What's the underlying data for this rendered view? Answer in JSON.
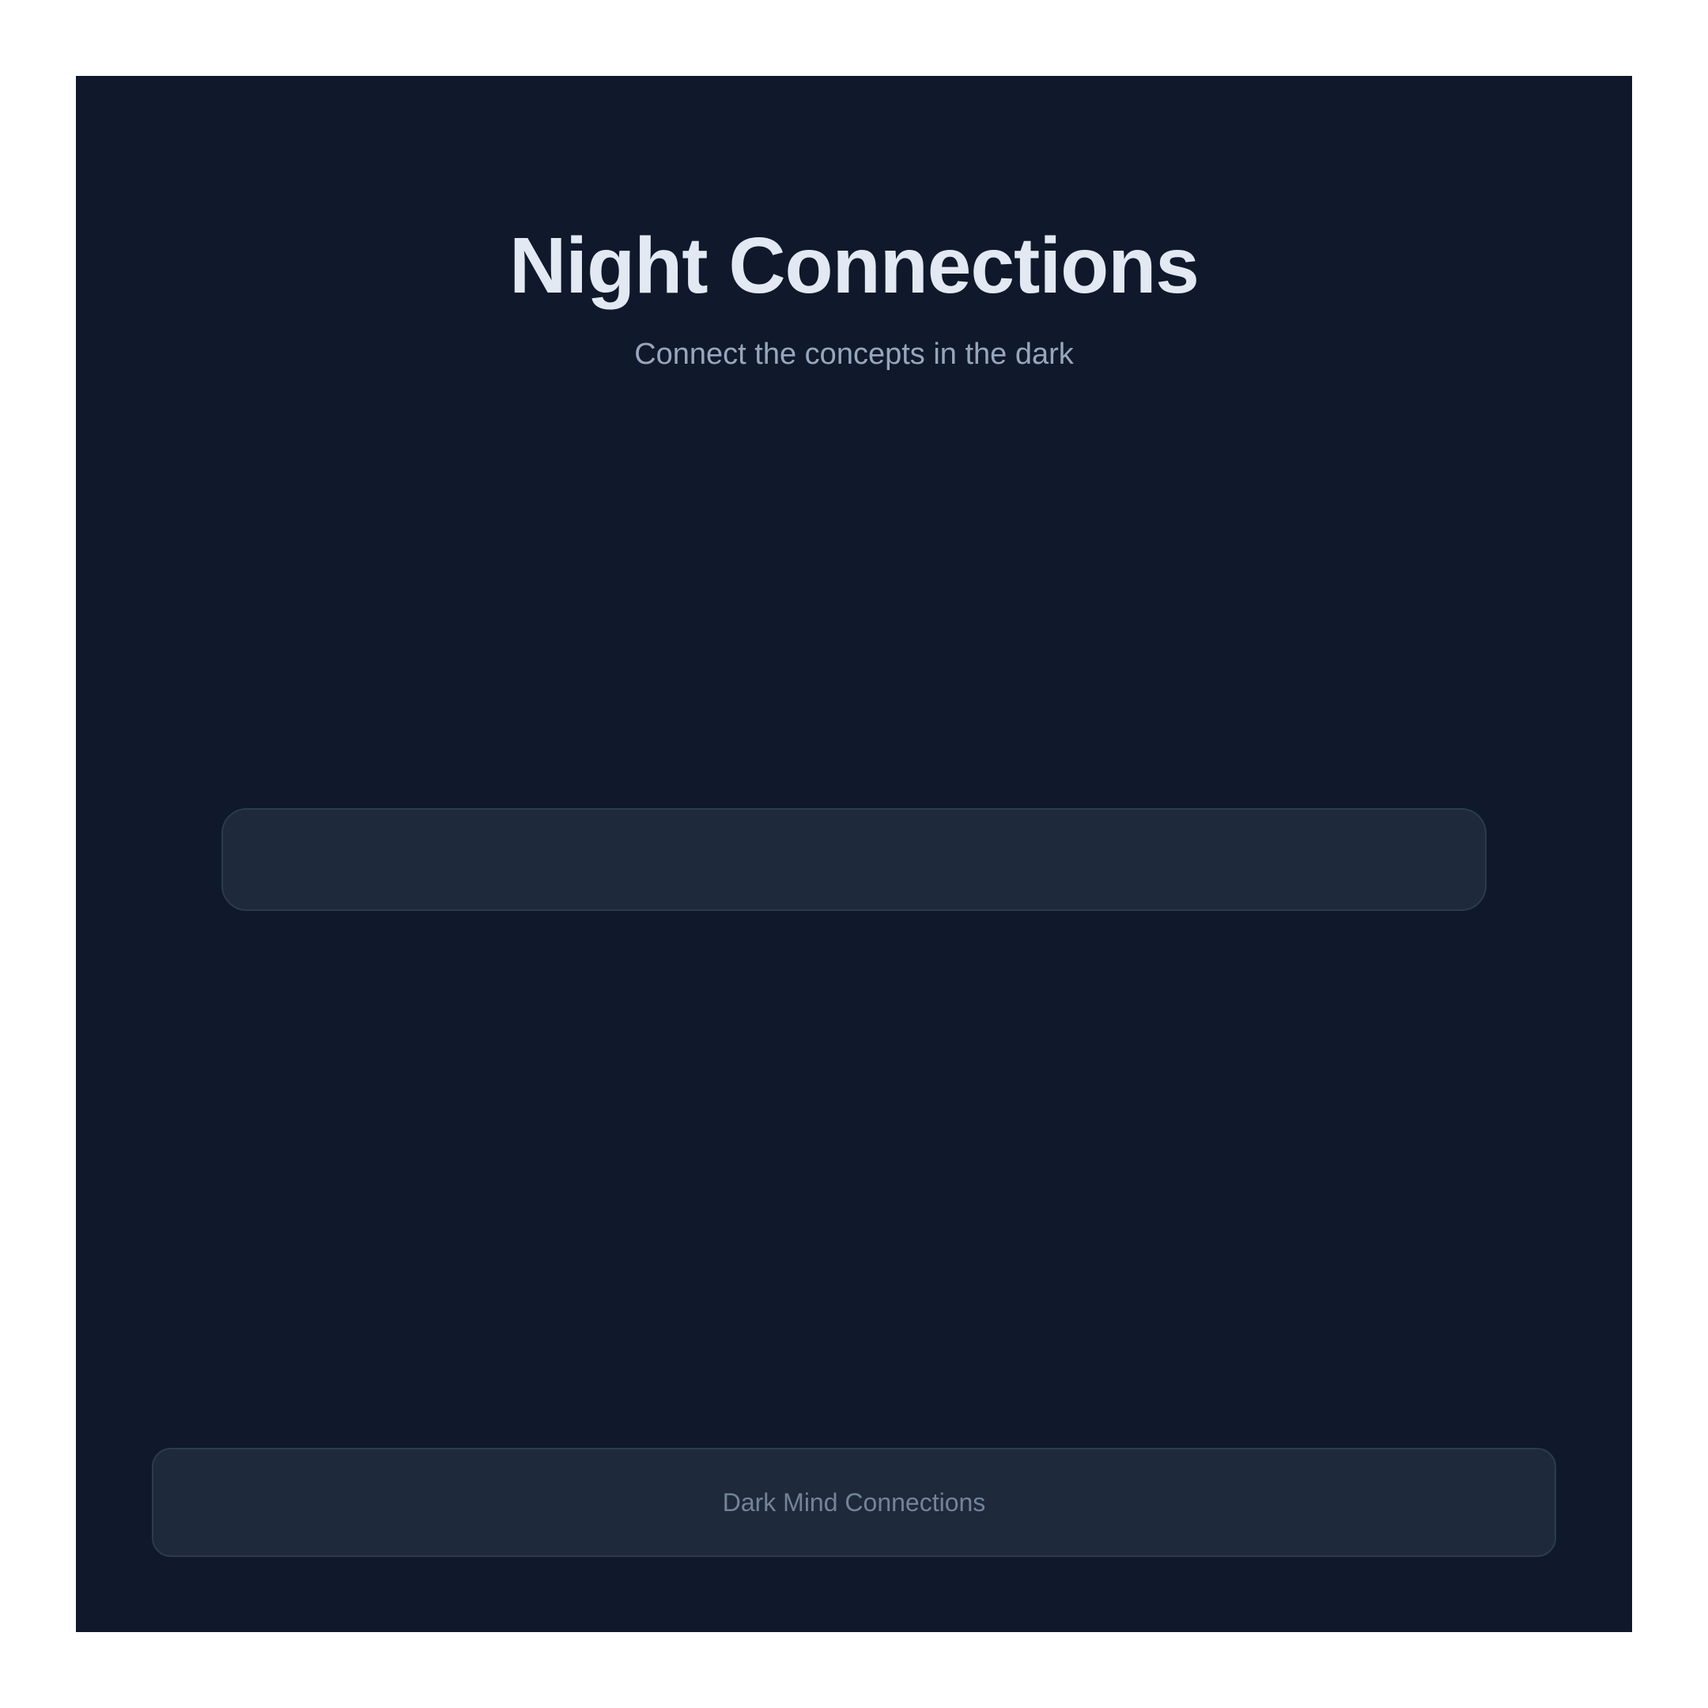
{
  "header": {
    "title": "Night Connections",
    "subtitle": "Connect the concepts in the dark"
  },
  "footer": {
    "label": "Dark Mind Connections"
  },
  "colors": {
    "background": "#0f192b",
    "panel": "#1e293b",
    "panel_border": "#2b3a4f",
    "title": "#e3e9f3",
    "subtitle": "#98a6bd",
    "footer_text": "#74839a"
  }
}
